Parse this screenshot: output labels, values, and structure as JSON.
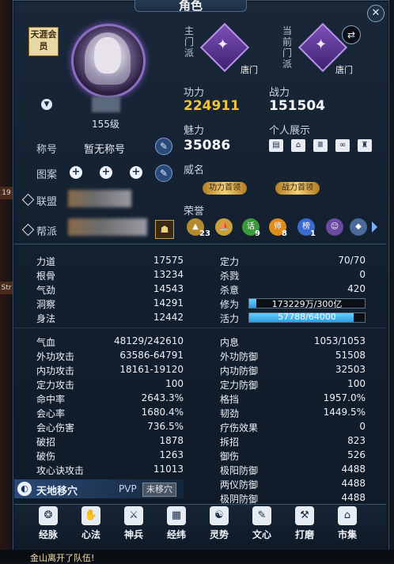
{
  "window": {
    "title": "角色",
    "close_icon": "close-icon"
  },
  "profile": {
    "member_badge": "天涯会员",
    "level": "155级",
    "title_label": "称号",
    "title_value": "暂无称号",
    "pattern_label": "图案",
    "alliance_label": "联盟",
    "guild_label": "帮派"
  },
  "sects": {
    "main_label": "主门派",
    "main_name": "唐门",
    "current_label": "当前门派",
    "current_name": "唐门"
  },
  "stats_top": {
    "gongli_label": "功力",
    "gongli_value": "224911",
    "zhanli_label": "战力",
    "zhanli_value": "151504",
    "meili_label": "魅力",
    "meili_value": "35086",
    "showcase_label": "个人展示",
    "weiming_label": "威名",
    "title_tag_1": "功力首领",
    "title_tag_2": "战力首领",
    "honor_label": "荣誉",
    "honor_counts": [
      "23",
      "9",
      "8",
      "1"
    ],
    "honor_glyphs": [
      "话",
      "师",
      "榜"
    ]
  },
  "attributes_left": [
    {
      "label": "力道",
      "value": "17575"
    },
    {
      "label": "根骨",
      "value": "13234"
    },
    {
      "label": "气劲",
      "value": "14543"
    },
    {
      "label": "洞察",
      "value": "14291"
    },
    {
      "label": "身法",
      "value": "12442"
    }
  ],
  "attributes_right": {
    "dingli_label": "定力",
    "dingli_value": "70/70",
    "shalu_label": "杀戮",
    "shalu_value": "0",
    "shayi_label": "杀意",
    "shayi_value": "420",
    "xiuwei_label": "修为",
    "xiuwei_text": "173229万/300亿",
    "xiuwei_fill": 0.06,
    "huoli_label": "活力",
    "huoli_text": "57788/64000",
    "huoli_fill": 0.903
  },
  "combat_left": [
    {
      "label": "气血",
      "value": "48129/242610"
    },
    {
      "label": "外功攻击",
      "value": "63586-64791"
    },
    {
      "label": "内功攻击",
      "value": "18161-19120"
    },
    {
      "label": "定力攻击",
      "value": "100"
    },
    {
      "label": "命中率",
      "value": "2643.3%"
    },
    {
      "label": "会心率",
      "value": "1680.4%"
    },
    {
      "label": "会心伤害",
      "value": "736.5%"
    },
    {
      "label": "破招",
      "value": "1878"
    },
    {
      "label": "破伤",
      "value": "1263"
    },
    {
      "label": "攻心诀攻击",
      "value": "11013"
    }
  ],
  "combat_right": [
    {
      "label": "内息",
      "value": "1053/1053"
    },
    {
      "label": "外功防御",
      "value": "51508"
    },
    {
      "label": "内功防御",
      "value": "32503"
    },
    {
      "label": "定力防御",
      "value": "100"
    },
    {
      "label": "格挡",
      "value": "1957.0%"
    },
    {
      "label": "韧劲",
      "value": "1449.5%"
    },
    {
      "label": "疗伤效果",
      "value": "0"
    },
    {
      "label": "拆招",
      "value": "823"
    },
    {
      "label": "御伤",
      "value": "526"
    },
    {
      "label": "极阳防御",
      "value": "4488"
    },
    {
      "label": "两仪防御",
      "value": "4488"
    },
    {
      "label": "极阴防御",
      "value": "4488"
    }
  ],
  "tiandi": {
    "label": "天地移穴",
    "pvp_label": "PVP",
    "pvp_status": "未移穴"
  },
  "bottom_nav": [
    {
      "label": "经脉",
      "icon": "meridian-icon"
    },
    {
      "label": "心法",
      "icon": "heart-method-icon"
    },
    {
      "label": "神兵",
      "icon": "weapon-icon"
    },
    {
      "label": "经纬",
      "icon": "grid-icon"
    },
    {
      "label": "灵势",
      "icon": "spirit-icon"
    },
    {
      "label": "文心",
      "icon": "brush-icon"
    },
    {
      "label": "打磨",
      "icon": "hammer-icon"
    },
    {
      "label": "市集",
      "icon": "market-icon"
    }
  ],
  "chat": {
    "message": "金山离开了队伍!"
  }
}
